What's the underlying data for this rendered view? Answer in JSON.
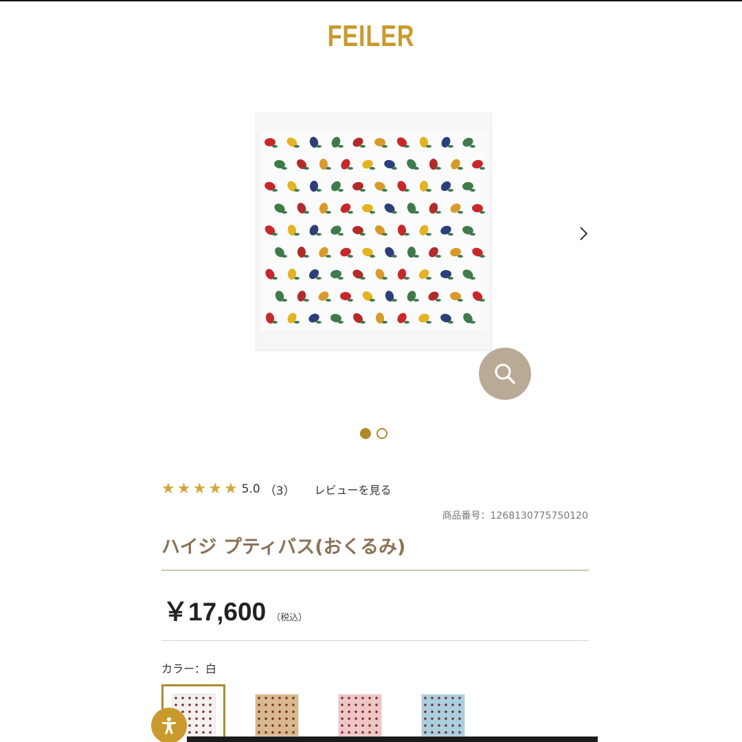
{
  "brand": {
    "logo_text": "FEILER",
    "accent": "#c99a2e"
  },
  "gallery": {
    "slide_count": 2,
    "active_slide": 1,
    "next_icon": "chevron-right-icon",
    "zoom_icon": "search-icon"
  },
  "rating": {
    "stars": 5,
    "value": "5.0",
    "count": "（3）",
    "review_link": "レビューを見る"
  },
  "product": {
    "number_label": "商品番号：1268130775750120",
    "name": "ハイジ プティバス(おくるみ)",
    "price": "￥17,600",
    "tax_note": "（税込）"
  },
  "color": {
    "label": "カラー：白",
    "options": [
      {
        "name": "白",
        "hex": "#f4f1ee",
        "selected": true
      },
      {
        "name": "beige",
        "hex": "#d9b88e",
        "selected": false
      },
      {
        "name": "pink",
        "hex": "#efc6c6",
        "selected": false
      },
      {
        "name": "blue",
        "hex": "#a9cfe0",
        "selected": false
      }
    ]
  },
  "accessibility": {
    "icon": "accessibility-icon"
  }
}
